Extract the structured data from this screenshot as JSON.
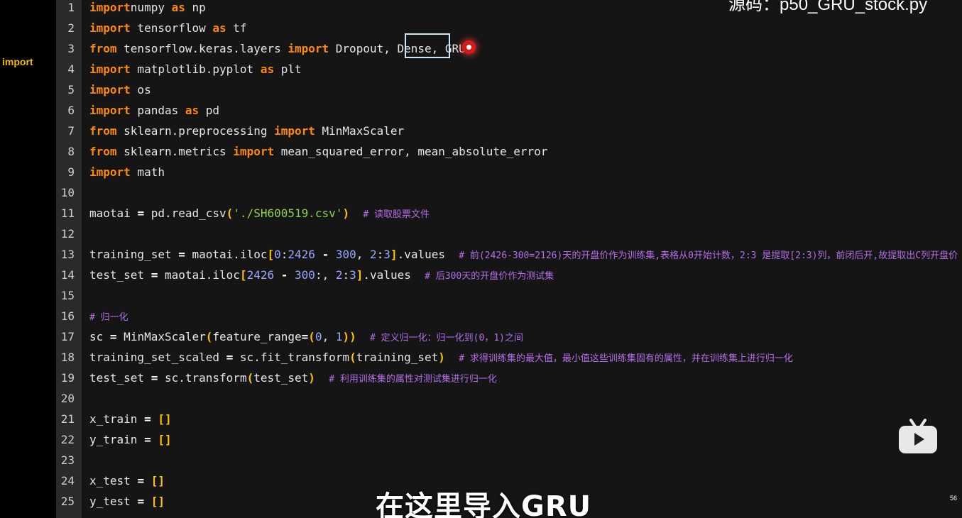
{
  "sidebar": {
    "label": "import"
  },
  "overlay": {
    "source_title": "源码：p50_GRU_stock.py",
    "subtitle": "在这里导入GRU",
    "page_number": "56",
    "logo_icon": "bilibili-tv-icon"
  },
  "colors": {
    "keyword": "#ff8a00",
    "string": "#8fd14a",
    "comment": "#b46ee8",
    "number": "#9aa6ff",
    "bracket": "#ffc107",
    "highlight_border": "#cfe6f7",
    "cursor": "#d91a1a"
  },
  "code": {
    "lines": [
      {
        "n": "1",
        "tokens": [
          [
            "kw",
            "import"
          ],
          [
            "",
            "numpy "
          ],
          [
            "kw",
            "as"
          ],
          [
            "",
            " np"
          ]
        ]
      },
      {
        "n": "2",
        "tokens": [
          [
            "kw",
            "import"
          ],
          [
            "",
            " tensorflow "
          ],
          [
            "kw",
            "as"
          ],
          [
            "",
            " tf"
          ]
        ]
      },
      {
        "n": "3",
        "tokens": [
          [
            "kw",
            "from"
          ],
          [
            "",
            " tensorflow.keras.layers "
          ],
          [
            "kw",
            "import"
          ],
          [
            "",
            " Dropout, Dense, GRU"
          ]
        ]
      },
      {
        "n": "4",
        "tokens": [
          [
            "kw",
            "import"
          ],
          [
            "",
            " matplotlib.pyplot "
          ],
          [
            "kw",
            "as"
          ],
          [
            "",
            " plt"
          ]
        ]
      },
      {
        "n": "5",
        "tokens": [
          [
            "kw",
            "import"
          ],
          [
            "",
            " os"
          ]
        ]
      },
      {
        "n": "6",
        "tokens": [
          [
            "kw",
            "import"
          ],
          [
            "",
            " pandas "
          ],
          [
            "kw",
            "as"
          ],
          [
            "",
            " pd"
          ]
        ]
      },
      {
        "n": "7",
        "tokens": [
          [
            "kw",
            "from"
          ],
          [
            "",
            " sklearn.preprocessing "
          ],
          [
            "kw",
            "import"
          ],
          [
            "",
            " MinMaxScaler"
          ]
        ]
      },
      {
        "n": "8",
        "tokens": [
          [
            "kw",
            "from"
          ],
          [
            "",
            " sklearn.metrics "
          ],
          [
            "kw",
            "import"
          ],
          [
            "",
            " mean_squared_error, mean_absolute_error"
          ]
        ]
      },
      {
        "n": "9",
        "tokens": [
          [
            "kw",
            "import"
          ],
          [
            "",
            " math"
          ]
        ]
      },
      {
        "n": "10",
        "tokens": []
      },
      {
        "n": "11",
        "tokens": [
          [
            "",
            "maotai "
          ],
          [
            "op",
            "="
          ],
          [
            "",
            " pd.read_csv"
          ],
          [
            "br",
            "("
          ],
          [
            "str",
            "'./SH600519.csv'"
          ],
          [
            "br",
            ")"
          ],
          [
            "",
            "  "
          ],
          [
            "cm",
            "# 读取股票文件"
          ]
        ]
      },
      {
        "n": "12",
        "tokens": []
      },
      {
        "n": "13",
        "tokens": [
          [
            "",
            "training_set "
          ],
          [
            "op",
            "="
          ],
          [
            "",
            " maotai.iloc"
          ],
          [
            "br",
            "["
          ],
          [
            "num",
            "0"
          ],
          [
            "",
            ":"
          ],
          [
            "num",
            "2426"
          ],
          [
            "",
            " "
          ],
          [
            "op",
            "-"
          ],
          [
            "",
            " "
          ],
          [
            "num",
            "300"
          ],
          [
            "",
            ", "
          ],
          [
            "num",
            "2"
          ],
          [
            "",
            ":"
          ],
          [
            "num",
            "3"
          ],
          [
            "br",
            "]"
          ],
          [
            "",
            ".values  "
          ],
          [
            "cm",
            "# 前(2426-300=2126)天的开盘价作为训练集,表格从0开始计数，2:3 是提取[2:3)列，前闭后开,故提取出C列开盘价"
          ]
        ]
      },
      {
        "n": "14",
        "tokens": [
          [
            "",
            "test_set "
          ],
          [
            "op",
            "="
          ],
          [
            "",
            " maotai.iloc"
          ],
          [
            "br",
            "["
          ],
          [
            "num",
            "2426"
          ],
          [
            "",
            " "
          ],
          [
            "op",
            "-"
          ],
          [
            "",
            " "
          ],
          [
            "num",
            "300"
          ],
          [
            "",
            ":, "
          ],
          [
            "num",
            "2"
          ],
          [
            "",
            ":"
          ],
          [
            "num",
            "3"
          ],
          [
            "br",
            "]"
          ],
          [
            "",
            ".values  "
          ],
          [
            "cm",
            "# 后300天的开盘价作为测试集"
          ]
        ]
      },
      {
        "n": "15",
        "tokens": []
      },
      {
        "n": "16",
        "tokens": [
          [
            "cm",
            "# 归一化"
          ]
        ]
      },
      {
        "n": "17",
        "tokens": [
          [
            "",
            "sc "
          ],
          [
            "op",
            "="
          ],
          [
            "",
            " MinMaxScaler"
          ],
          [
            "br",
            "("
          ],
          [
            "",
            "feature_range"
          ],
          [
            "op",
            "="
          ],
          [
            "br",
            "("
          ],
          [
            "num",
            "0"
          ],
          [
            "",
            ", "
          ],
          [
            "num",
            "1"
          ],
          [
            "br",
            "))"
          ],
          [
            "",
            "  "
          ],
          [
            "cm",
            "# 定义归一化：归一化到(0，1)之间"
          ]
        ]
      },
      {
        "n": "18",
        "tokens": [
          [
            "",
            "training_set_scaled "
          ],
          [
            "op",
            "="
          ],
          [
            "",
            " sc.fit_transform"
          ],
          [
            "br",
            "("
          ],
          [
            "",
            "training_set"
          ],
          [
            "br",
            ")"
          ],
          [
            "",
            "  "
          ],
          [
            "cm",
            "# 求得训练集的最大值，最小值这些训练集固有的属性，并在训练集上进行归一化"
          ]
        ]
      },
      {
        "n": "19",
        "tokens": [
          [
            "",
            "test_set "
          ],
          [
            "op",
            "="
          ],
          [
            "",
            " sc.transform"
          ],
          [
            "br",
            "("
          ],
          [
            "",
            "test_set"
          ],
          [
            "br",
            ")"
          ],
          [
            "",
            "  "
          ],
          [
            "cm",
            "# 利用训练集的属性对测试集进行归一化"
          ]
        ]
      },
      {
        "n": "20",
        "tokens": []
      },
      {
        "n": "21",
        "tokens": [
          [
            "",
            "x_train "
          ],
          [
            "op",
            "="
          ],
          [
            "",
            " "
          ],
          [
            "br",
            "[]"
          ]
        ]
      },
      {
        "n": "22",
        "tokens": [
          [
            "",
            "y_train "
          ],
          [
            "op",
            "="
          ],
          [
            "",
            " "
          ],
          [
            "br",
            "[]"
          ]
        ]
      },
      {
        "n": "23",
        "tokens": []
      },
      {
        "n": "24",
        "tokens": [
          [
            "",
            "x_test "
          ],
          [
            "op",
            "="
          ],
          [
            "",
            " "
          ],
          [
            "br",
            "[]"
          ]
        ]
      },
      {
        "n": "25",
        "tokens": [
          [
            "",
            "y_test "
          ],
          [
            "op",
            "="
          ],
          [
            "",
            " "
          ],
          [
            "br",
            "[]"
          ]
        ]
      }
    ]
  }
}
